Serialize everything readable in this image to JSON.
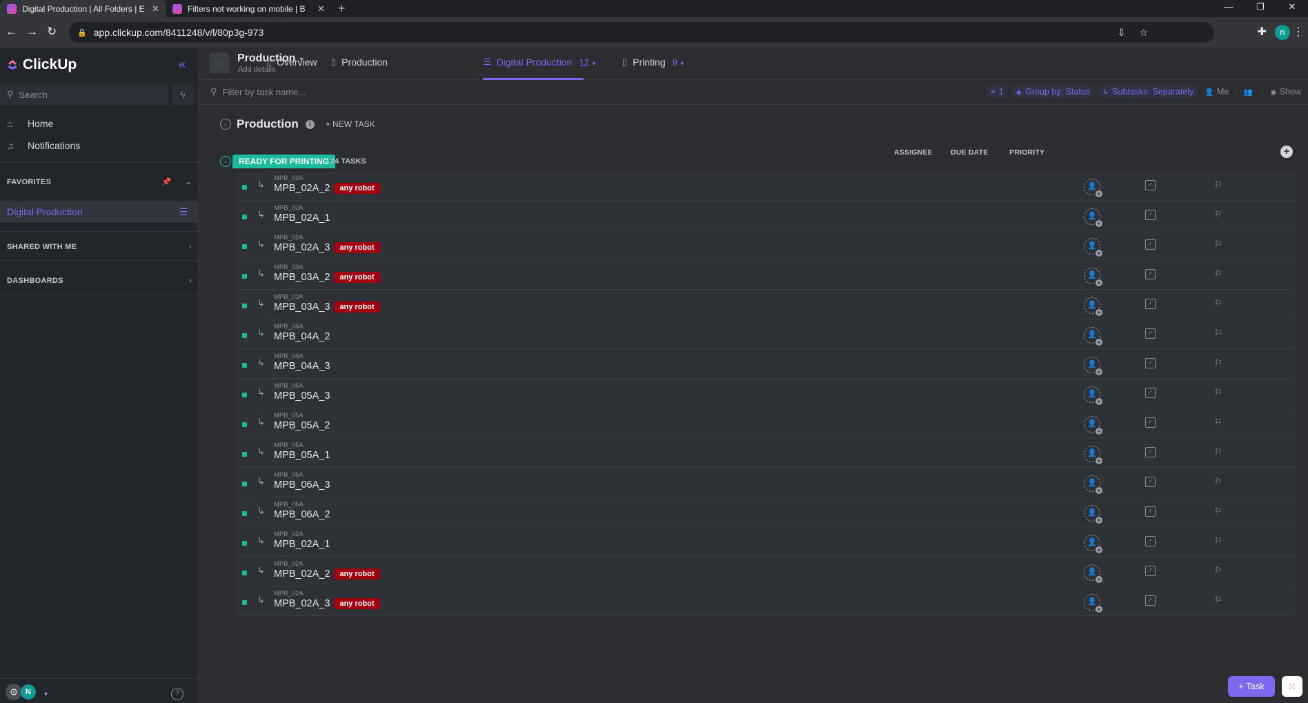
{
  "browser": {
    "tabs": [
      {
        "title": "Digital Production | All Folders | E",
        "close": "✕"
      },
      {
        "title": "Filters not working on mobile | B",
        "close": "✕"
      }
    ],
    "new_tab": "+",
    "url": "app.clickup.com/8411248/v/l/80p3g-973",
    "profile_initial": "n"
  },
  "sidebar": {
    "brand": "ClickUp",
    "search_placeholder": "Search",
    "nav": [
      {
        "label": "Home",
        "icon": "home-icon"
      },
      {
        "label": "Notifications",
        "icon": "bell-icon"
      }
    ],
    "favorites_label": "FAVORITES",
    "favorite_item": "Digital Production",
    "shared_label": "SHARED WITH ME",
    "dashboards_label": "DASHBOARDS",
    "user_initial": "N"
  },
  "header": {
    "space_name": "Production",
    "space_sub": "Add details",
    "views": [
      {
        "label": "Overview",
        "icon": "doc-icon"
      },
      {
        "label": "Production",
        "icon": "doc-icon"
      },
      {
        "label": "Digital Production",
        "icon": "list-icon",
        "count": "12"
      },
      {
        "label": "Printing",
        "icon": "doc-icon",
        "count": "9"
      }
    ]
  },
  "toolbar": {
    "filter_placeholder": "Filter by task name...",
    "filter_count": "1",
    "group_by": "Group by: Status",
    "subtasks": "Subtasks: Separately",
    "me": "Me",
    "show": "Show"
  },
  "list": {
    "title": "Production",
    "new_task": "+ NEW TASK",
    "group": {
      "status": "READY FOR PRINTING",
      "count": "24 TASKS",
      "status_color": "#1abc9c"
    },
    "columns": [
      "ASSIGNEE",
      "DUE DATE",
      "PRIORITY"
    ],
    "tag_color": "#a3000f",
    "rows": [
      {
        "parent": "MPB_02A",
        "name": "MPB_02A_2",
        "tag": "any robot"
      },
      {
        "parent": "MPB_02A",
        "name": "MPB_02A_1",
        "tag": ""
      },
      {
        "parent": "MPB_02A",
        "name": "MPB_02A_3",
        "tag": "any robot"
      },
      {
        "parent": "MPB_03A",
        "name": "MPB_03A_2",
        "tag": "any robot"
      },
      {
        "parent": "MPB_03A",
        "name": "MPB_03A_3",
        "tag": "any robot"
      },
      {
        "parent": "MPB_04A",
        "name": "MPB_04A_2",
        "tag": ""
      },
      {
        "parent": "MPB_04A",
        "name": "MPB_04A_3",
        "tag": ""
      },
      {
        "parent": "MPB_05A",
        "name": "MPB_05A_3",
        "tag": ""
      },
      {
        "parent": "MPB_05A",
        "name": "MPB_05A_2",
        "tag": ""
      },
      {
        "parent": "MPB_05A",
        "name": "MPB_05A_1",
        "tag": ""
      },
      {
        "parent": "MPB_06A",
        "name": "MPB_06A_3",
        "tag": ""
      },
      {
        "parent": "MPB_06A",
        "name": "MPB_06A_2",
        "tag": ""
      },
      {
        "parent": "MPB_02A",
        "name": "MPB_02A_1",
        "tag": ""
      },
      {
        "parent": "MPB_02A",
        "name": "MPB_02A_2",
        "tag": "any robot"
      },
      {
        "parent": "MPB_02A",
        "name": "MPB_02A_3",
        "tag": "any robot"
      }
    ]
  },
  "fab": {
    "task_label": "+ Task"
  }
}
